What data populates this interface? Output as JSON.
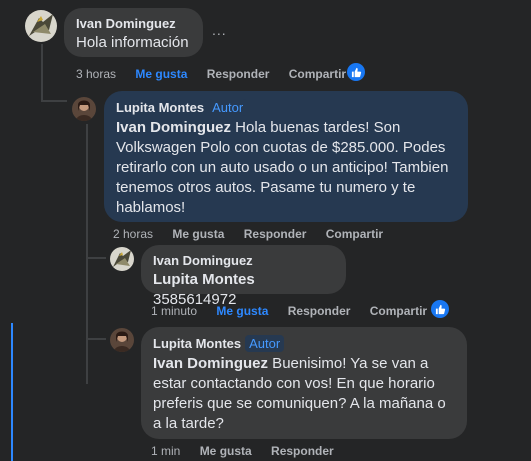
{
  "comments": [
    {
      "author": "Ivan Dominguez",
      "text": "Hola información",
      "time": "3 horas",
      "actions": [
        "Me gusta",
        "Responder",
        "Compartir"
      ],
      "more": "..."
    },
    {
      "author": "Lupita Montes",
      "badge": "Autor",
      "mention": "Ivan Dominguez",
      "text": " Hola buenas tardes! Son Volkswagen Polo con cuotas de $285.000. Podes retirarlo con un auto usado o un anticipo! Tambien tenemos otros autos. Pasame tu numero y te hablamos!",
      "time": "2 horas",
      "actions": [
        "Me gusta",
        "Responder",
        "Compartir"
      ]
    },
    {
      "author": "Ivan Dominguez",
      "mention": "Lupita Montes",
      "text": " 3585614972",
      "time": "1 minuto",
      "actions": [
        "Me gusta",
        "Responder",
        "Compartir"
      ]
    },
    {
      "author": "Lupita Montes",
      "badge": "Autor",
      "mention": "Ivan Dominguez",
      "text": " Buenisimo! Ya se van a estar contactando con vos! En que horario preferis que se comuniquen? A la mañana o a la tarde?",
      "time": "1 min",
      "actions": [
        "Me gusta",
        "Responder"
      ]
    }
  ],
  "colors": {
    "accent": "#2d88ff",
    "bubble": "#3a3b3c",
    "highlight": "#263951"
  }
}
